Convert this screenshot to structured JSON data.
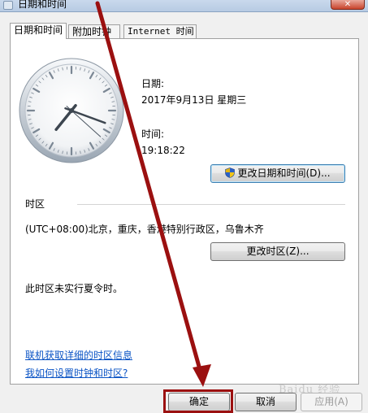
{
  "window": {
    "title": "日期和时间",
    "close_glyph": "✕"
  },
  "tabs": [
    {
      "label": "日期和时间",
      "active": true
    },
    {
      "label": "附加时钟",
      "active": false
    },
    {
      "label": "Internet 时间",
      "active": false
    }
  ],
  "date_section": {
    "date_label": "日期:",
    "date_value": "2017年9月13日 星期三",
    "time_label": "时间:",
    "time_value": "19:18:22",
    "change_datetime_button": "更改日期和时间(D)...",
    "change_datetime_icon": "uac-shield-icon"
  },
  "timezone_section": {
    "header": "时区",
    "value": "(UTC+08:00)北京，重庆，香港特别行政区，乌鲁木齐",
    "change_timezone_button": "更改时区(Z)...",
    "dst_note": "此时区未实行夏令时。"
  },
  "links": {
    "timezone_info": "联机获取详细的时区信息",
    "how_to_set": "我如何设置时钟和时区?"
  },
  "dialog_buttons": {
    "ok": "确定",
    "cancel": "取消",
    "apply": "应用(A)"
  },
  "clock": {
    "hour": 7,
    "minute": 18,
    "second": 22
  },
  "annotation": {
    "color": "#9b1010",
    "watermark": "Baidu 经验"
  }
}
